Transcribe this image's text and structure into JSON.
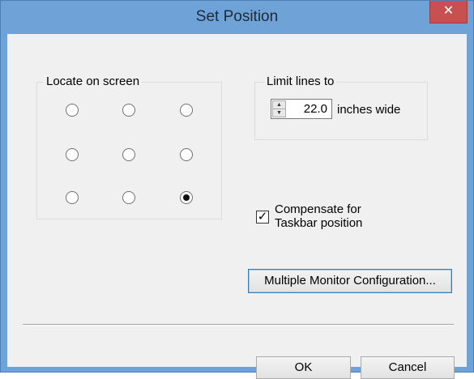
{
  "window": {
    "title": "Set Position",
    "close_label": "✕"
  },
  "locate": {
    "legend": "Locate on screen",
    "selected": "bottom-right"
  },
  "limit": {
    "legend": "Limit lines to",
    "value": "22.0",
    "unit_label": "inches wide"
  },
  "compensate": {
    "checked": true,
    "label_line1": "Compensate for",
    "label_line2": "Taskbar position",
    "check_glyph": "✓"
  },
  "buttons": {
    "multi_monitor": "Multiple Monitor Configuration...",
    "ok": "OK",
    "cancel": "Cancel"
  },
  "colors": {
    "titlebar": "#6fa3d8",
    "close_button": "#c75050",
    "dialog_background": "#f0f0f0"
  }
}
